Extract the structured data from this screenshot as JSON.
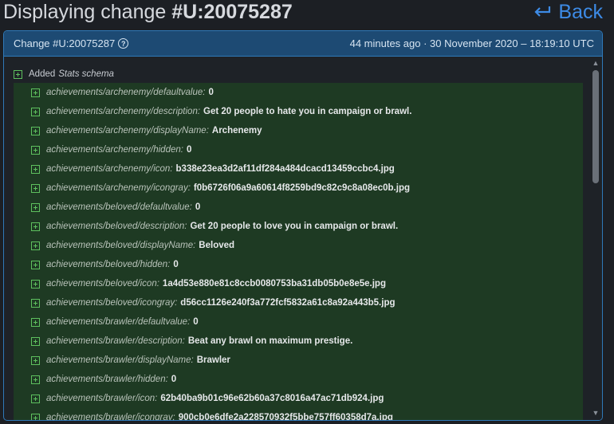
{
  "header": {
    "title_prefix": "Displaying change ",
    "title_id": "#U:20075287",
    "back_label": "Back"
  },
  "panel": {
    "change_label": "Change #U:20075287",
    "meta": "44 minutes ago · 30 November 2020 – 18:19:10 UTC",
    "root_label": "Added",
    "root_em": "Stats schema",
    "entries": [
      {
        "key": "achievements/archenemy/defaultvalue:",
        "value": "0"
      },
      {
        "key": "achievements/archenemy/description:",
        "value": "Get 20 people to hate you in campaign or brawl."
      },
      {
        "key": "achievements/archenemy/displayName:",
        "value": "Archenemy"
      },
      {
        "key": "achievements/archenemy/hidden:",
        "value": "0"
      },
      {
        "key": "achievements/archenemy/icon:",
        "value": "b338e23ea3d2af11df284a484dcacd13459ccbc4.jpg"
      },
      {
        "key": "achievements/archenemy/icongray:",
        "value": "f0b6726f06a9a60614f8259bd9c82c9c8a08ec0b.jpg"
      },
      {
        "key": "achievements/beloved/defaultvalue:",
        "value": "0"
      },
      {
        "key": "achievements/beloved/description:",
        "value": "Get 20 people to love you in campaign or brawl."
      },
      {
        "key": "achievements/beloved/displayName:",
        "value": "Beloved"
      },
      {
        "key": "achievements/beloved/hidden:",
        "value": "0"
      },
      {
        "key": "achievements/beloved/icon:",
        "value": "1a4d53e880e81c8ccb0080753ba31db05b0e8e5e.jpg"
      },
      {
        "key": "achievements/beloved/icongray:",
        "value": "d56cc1126e240f3a772fcf5832a61c8a92a443b5.jpg"
      },
      {
        "key": "achievements/brawler/defaultvalue:",
        "value": "0"
      },
      {
        "key": "achievements/brawler/description:",
        "value": "Beat any brawl on maximum prestige."
      },
      {
        "key": "achievements/brawler/displayName:",
        "value": "Brawler"
      },
      {
        "key": "achievements/brawler/hidden:",
        "value": "0"
      },
      {
        "key": "achievements/brawler/icon:",
        "value": "62b40ba9b01c96e62b60a37c8016a47ac71db924.jpg"
      },
      {
        "key": "achievements/brawler/icongray:",
        "value": "900cb0e6dfe2a228570932f5bbe757ff60358d7a.jpg"
      }
    ]
  },
  "colors": {
    "accent": "#3d8be6",
    "added_bg": "#1e3a23",
    "plus": "#5ec05e",
    "header_bg": "#1d4a73"
  }
}
